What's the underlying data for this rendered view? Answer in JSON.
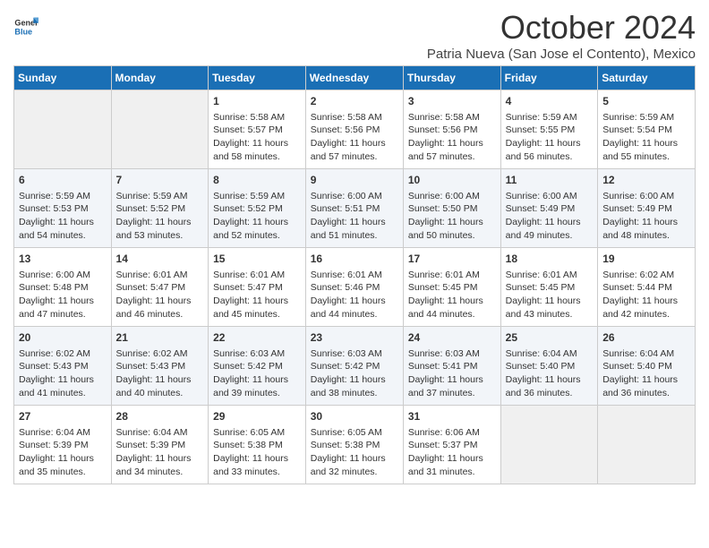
{
  "header": {
    "logo_line1": "General",
    "logo_line2": "Blue",
    "month": "October 2024",
    "location": "Patria Nueva (San Jose el Contento), Mexico"
  },
  "days_of_week": [
    "Sunday",
    "Monday",
    "Tuesday",
    "Wednesday",
    "Thursday",
    "Friday",
    "Saturday"
  ],
  "weeks": [
    [
      {
        "day": "",
        "empty": true
      },
      {
        "day": "",
        "empty": true
      },
      {
        "day": "1",
        "sunrise": "5:58 AM",
        "sunset": "5:57 PM",
        "daylight": "11 hours and 58 minutes."
      },
      {
        "day": "2",
        "sunrise": "5:58 AM",
        "sunset": "5:56 PM",
        "daylight": "11 hours and 57 minutes."
      },
      {
        "day": "3",
        "sunrise": "5:58 AM",
        "sunset": "5:56 PM",
        "daylight": "11 hours and 57 minutes."
      },
      {
        "day": "4",
        "sunrise": "5:59 AM",
        "sunset": "5:55 PM",
        "daylight": "11 hours and 56 minutes."
      },
      {
        "day": "5",
        "sunrise": "5:59 AM",
        "sunset": "5:54 PM",
        "daylight": "11 hours and 55 minutes."
      }
    ],
    [
      {
        "day": "6",
        "sunrise": "5:59 AM",
        "sunset": "5:53 PM",
        "daylight": "11 hours and 54 minutes."
      },
      {
        "day": "7",
        "sunrise": "5:59 AM",
        "sunset": "5:52 PM",
        "daylight": "11 hours and 53 minutes."
      },
      {
        "day": "8",
        "sunrise": "5:59 AM",
        "sunset": "5:52 PM",
        "daylight": "11 hours and 52 minutes."
      },
      {
        "day": "9",
        "sunrise": "6:00 AM",
        "sunset": "5:51 PM",
        "daylight": "11 hours and 51 minutes."
      },
      {
        "day": "10",
        "sunrise": "6:00 AM",
        "sunset": "5:50 PM",
        "daylight": "11 hours and 50 minutes."
      },
      {
        "day": "11",
        "sunrise": "6:00 AM",
        "sunset": "5:49 PM",
        "daylight": "11 hours and 49 minutes."
      },
      {
        "day": "12",
        "sunrise": "6:00 AM",
        "sunset": "5:49 PM",
        "daylight": "11 hours and 48 minutes."
      }
    ],
    [
      {
        "day": "13",
        "sunrise": "6:00 AM",
        "sunset": "5:48 PM",
        "daylight": "11 hours and 47 minutes."
      },
      {
        "day": "14",
        "sunrise": "6:01 AM",
        "sunset": "5:47 PM",
        "daylight": "11 hours and 46 minutes."
      },
      {
        "day": "15",
        "sunrise": "6:01 AM",
        "sunset": "5:47 PM",
        "daylight": "11 hours and 45 minutes."
      },
      {
        "day": "16",
        "sunrise": "6:01 AM",
        "sunset": "5:46 PM",
        "daylight": "11 hours and 44 minutes."
      },
      {
        "day": "17",
        "sunrise": "6:01 AM",
        "sunset": "5:45 PM",
        "daylight": "11 hours and 44 minutes."
      },
      {
        "day": "18",
        "sunrise": "6:01 AM",
        "sunset": "5:45 PM",
        "daylight": "11 hours and 43 minutes."
      },
      {
        "day": "19",
        "sunrise": "6:02 AM",
        "sunset": "5:44 PM",
        "daylight": "11 hours and 42 minutes."
      }
    ],
    [
      {
        "day": "20",
        "sunrise": "6:02 AM",
        "sunset": "5:43 PM",
        "daylight": "11 hours and 41 minutes."
      },
      {
        "day": "21",
        "sunrise": "6:02 AM",
        "sunset": "5:43 PM",
        "daylight": "11 hours and 40 minutes."
      },
      {
        "day": "22",
        "sunrise": "6:03 AM",
        "sunset": "5:42 PM",
        "daylight": "11 hours and 39 minutes."
      },
      {
        "day": "23",
        "sunrise": "6:03 AM",
        "sunset": "5:42 PM",
        "daylight": "11 hours and 38 minutes."
      },
      {
        "day": "24",
        "sunrise": "6:03 AM",
        "sunset": "5:41 PM",
        "daylight": "11 hours and 37 minutes."
      },
      {
        "day": "25",
        "sunrise": "6:04 AM",
        "sunset": "5:40 PM",
        "daylight": "11 hours and 36 minutes."
      },
      {
        "day": "26",
        "sunrise": "6:04 AM",
        "sunset": "5:40 PM",
        "daylight": "11 hours and 36 minutes."
      }
    ],
    [
      {
        "day": "27",
        "sunrise": "6:04 AM",
        "sunset": "5:39 PM",
        "daylight": "11 hours and 35 minutes."
      },
      {
        "day": "28",
        "sunrise": "6:04 AM",
        "sunset": "5:39 PM",
        "daylight": "11 hours and 34 minutes."
      },
      {
        "day": "29",
        "sunrise": "6:05 AM",
        "sunset": "5:38 PM",
        "daylight": "11 hours and 33 minutes."
      },
      {
        "day": "30",
        "sunrise": "6:05 AM",
        "sunset": "5:38 PM",
        "daylight": "11 hours and 32 minutes."
      },
      {
        "day": "31",
        "sunrise": "6:06 AM",
        "sunset": "5:37 PM",
        "daylight": "11 hours and 31 minutes."
      },
      {
        "day": "",
        "empty": true
      },
      {
        "day": "",
        "empty": true
      }
    ]
  ],
  "labels": {
    "sunrise_prefix": "Sunrise: ",
    "sunset_prefix": "Sunset: ",
    "daylight_prefix": "Daylight: "
  }
}
